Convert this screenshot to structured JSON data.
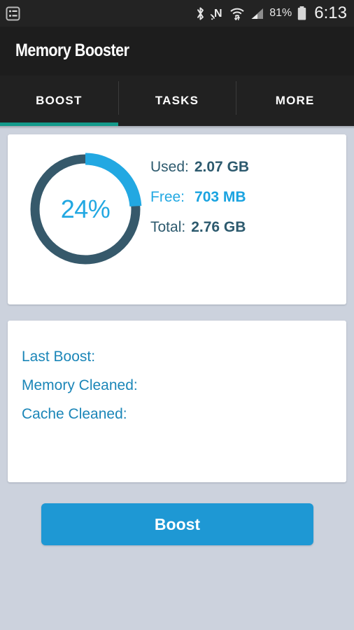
{
  "statusbar": {
    "notification_icon": "list-notification-icon",
    "icons": [
      "bluetooth-icon",
      "nfc-icon",
      "wifi-icon",
      "cellular-signal-icon"
    ],
    "battery_percent": "81%",
    "battery_icon": "battery-icon",
    "clock": "6:13"
  },
  "appbar": {
    "title": "Memory Booster"
  },
  "tabs": [
    {
      "label": "BOOST",
      "active": true
    },
    {
      "label": "TASKS",
      "active": false
    },
    {
      "label": "MORE",
      "active": false
    }
  ],
  "memory_card": {
    "gauge": {
      "percent_label": "24%",
      "percent_value": 24,
      "track_color": "#36596b",
      "arc_color": "#22a8e2"
    },
    "rows": [
      {
        "key": "Used:",
        "value": "2.07 GB",
        "accent": false
      },
      {
        "key": "Free:",
        "value": "703 MB",
        "accent": true
      },
      {
        "key": "Total:",
        "value": "2.76 GB",
        "accent": false
      }
    ]
  },
  "stats_card": {
    "rows": [
      {
        "key": "Last Boost:",
        "value": ""
      },
      {
        "key": "Memory Cleaned:",
        "value": ""
      },
      {
        "key": "Cache Cleaned:",
        "value": ""
      }
    ]
  },
  "boost_button": {
    "label": "Boost",
    "color": "#1e98d4"
  },
  "colors": {
    "background": "#ccd2dd",
    "appbar": "#1d1d1d",
    "tabbar": "#212121",
    "tab_indicator": "#139a8b",
    "accent_blue": "#22a8e2",
    "dark_slate": "#2d5a6e",
    "stats_blue": "#1b86b8"
  }
}
